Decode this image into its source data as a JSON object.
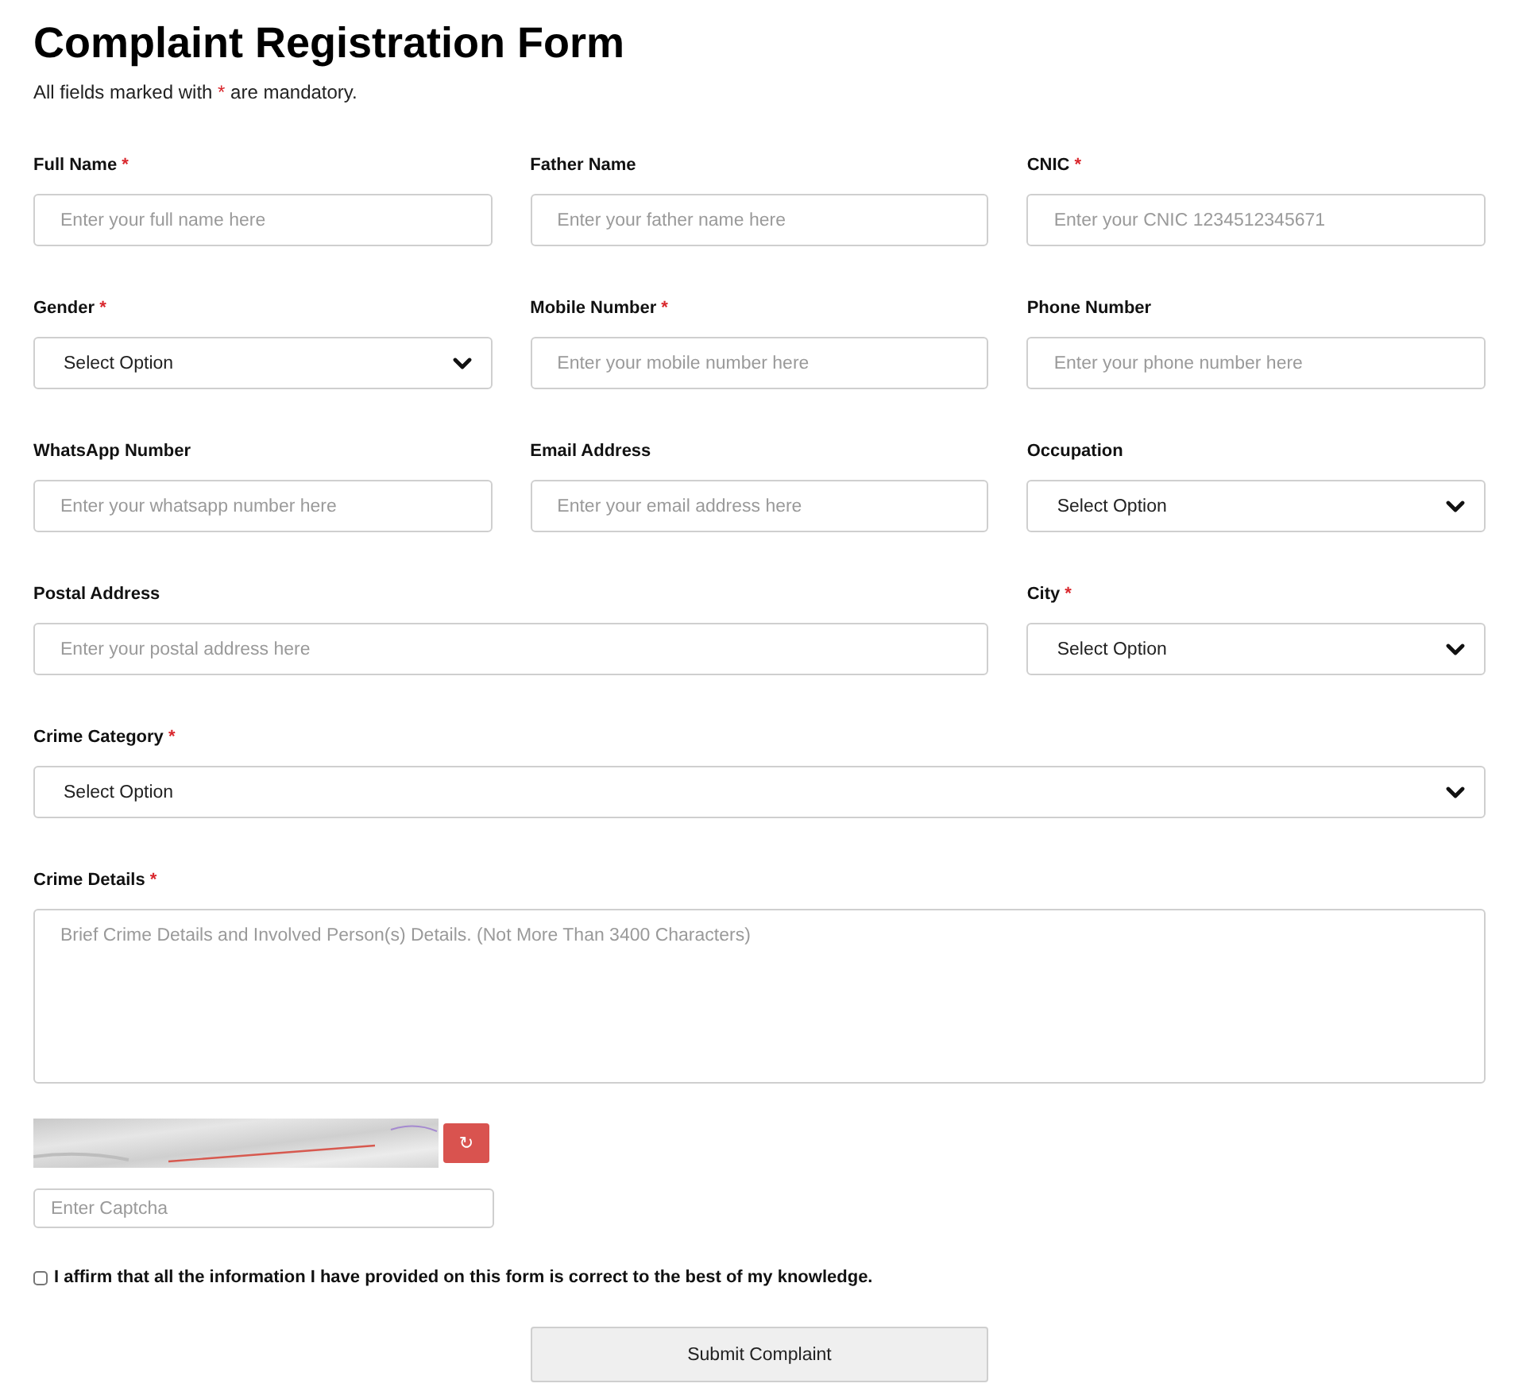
{
  "title": "Complaint Registration Form",
  "note": {
    "text_before": "All fields marked with",
    "required_mark": "*",
    "text_after": "are mandatory."
  },
  "rows": [
    [
      {
        "label": "Full Name",
        "required_mark": "*",
        "kind": "text",
        "placeholder": "Enter your full name here"
      },
      {
        "label": "Father Name",
        "kind": "text",
        "placeholder": "Enter your father name here"
      },
      {
        "label": "CNIC",
        "required_mark": "*",
        "kind": "text",
        "placeholder": "Enter your CNIC 1234512345671"
      }
    ],
    [
      {
        "label": "Gender",
        "required_mark": "*",
        "kind": "select",
        "value": "Select Option"
      },
      {
        "label": "Mobile Number",
        "required_mark": "*",
        "kind": "text",
        "placeholder": "Enter your mobile number here"
      },
      {
        "label": "Phone Number",
        "kind": "text",
        "placeholder": "Enter your phone number here"
      }
    ],
    [
      {
        "label": "WhatsApp Number",
        "kind": "text",
        "placeholder": "Enter your whatsapp number here"
      },
      {
        "label": "Email Address",
        "kind": "text",
        "placeholder": "Enter your email address here"
      },
      {
        "label": "Occupation",
        "kind": "select",
        "value": "Select Option"
      }
    ],
    [
      {
        "label": "Postal Address",
        "kind": "text",
        "placeholder": "Enter your postal address here"
      },
      {
        "label": "City",
        "required_mark": "*",
        "kind": "select",
        "value": "Select Option"
      }
    ],
    [
      {
        "label": "Crime Category",
        "required_mark": "*",
        "kind": "select",
        "value": "Select Option"
      }
    ],
    [
      {
        "label": "Crime Details",
        "required_mark": "*",
        "kind": "textarea",
        "placeholder": "Brief Crime Details and Involved Person(s) Details. (Not More Than 3400 Characters)"
      }
    ]
  ],
  "captcha": {
    "refresh": "↻",
    "placeholder": "Enter Captcha"
  },
  "agreement": {
    "checked": false,
    "text": "I affirm that all the information I have provided on this form is correct to the best of my knowledge."
  },
  "submit": {
    "label": "Submit Complaint"
  }
}
